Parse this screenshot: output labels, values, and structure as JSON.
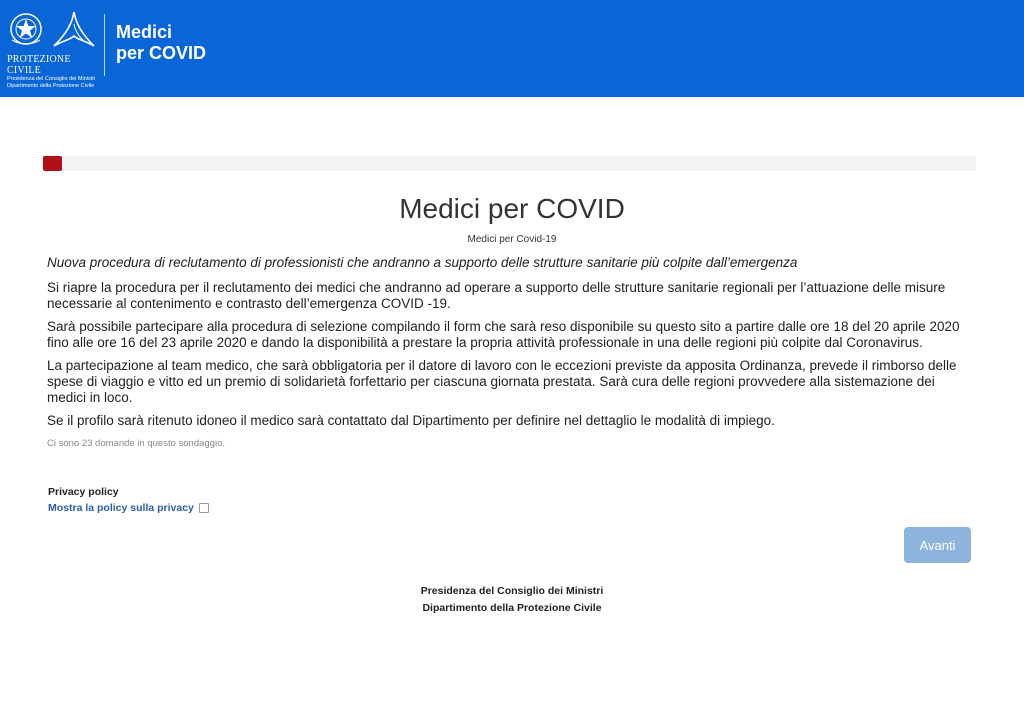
{
  "header": {
    "logo_org": "PROTEZIONE CIVILE",
    "logo_sub1": "Presidenza del Consiglio dei Ministri",
    "logo_sub2": "Dipartimento della Protezione Civile",
    "brand_line1": "Medici",
    "brand_line2": "per COVID",
    "bg_color": "#0a66d6"
  },
  "progress": {
    "value_percent": 2,
    "color": "#b11116"
  },
  "survey": {
    "title": "Medici per COVID",
    "subtitle": "Medici per Covid-19",
    "intro": "Nuova procedura di reclutamento di professionisti che andranno a supporto delle strutture sanitarie più colpite dall’emergenza",
    "paragraphs": [
      "Si riapre la procedura per il reclutamento dei medici che andranno ad operare a supporto delle strutture sanitarie regionali per l’attuazione delle misure necessarie al contenimento e contrasto dell’emergenza COVID -19.",
      "Sarà possibile partecipare alla procedura di selezione compilando il form che sarà reso disponibile su questo sito a partire dalle ore 18 del 20 aprile 2020 fino alle ore 16 del 23 aprile 2020 e dando la disponibilità a prestare la propria attività professionale in una delle regioni più colpite dal Coronavirus.",
      "La partecipazione al team medico, che sarà obbligatoria per il datore di lavoro con le eccezioni previste da apposita Ordinanza, prevede il rimborso delle spese di viaggio e vitto ed un premio di solidarietà forfettario per ciascuna giornata prestata.  Sarà cura delle regioni provvedere alla sistemazione dei medici in loco.",
      "Se il profilo sarà ritenuto idoneo il medico sarà contattato dal Dipartimento per definire nel dettaglio le modalità di impiego."
    ],
    "question_count_text": "Ci sono 23 domande in questo sondaggio."
  },
  "privacy": {
    "heading": "Privacy policy",
    "link_label": "Mostra la policy sulla privacy",
    "checked": false
  },
  "buttons": {
    "next_label": "Avanti"
  },
  "footer": {
    "line1": "Presidenza del Consiglio dei Ministri",
    "line2": "Dipartimento della Protezione Civile"
  }
}
